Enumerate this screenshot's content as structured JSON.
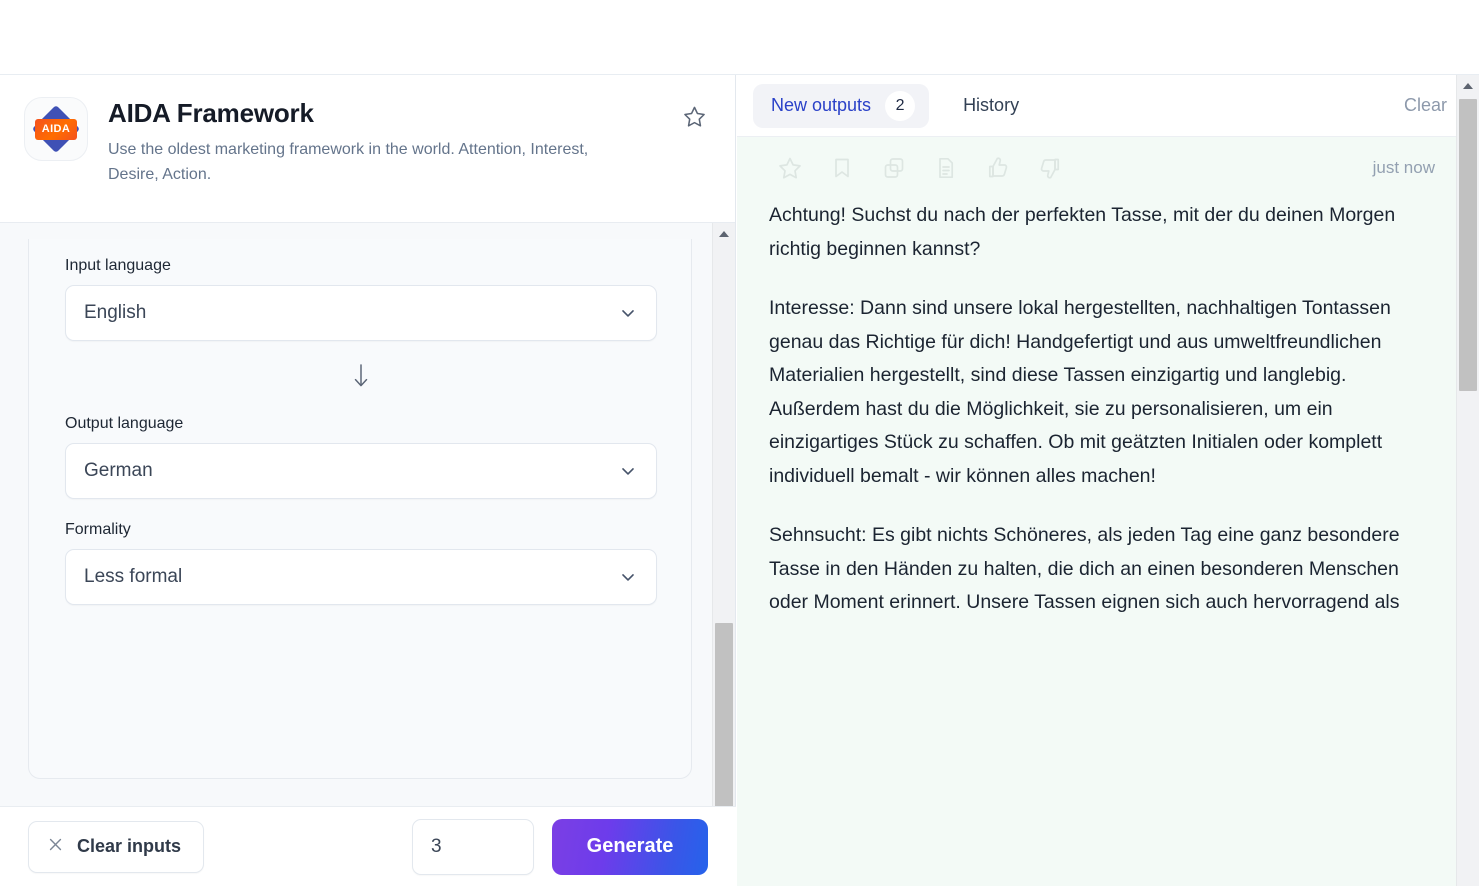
{
  "tool": {
    "logo_text": "AIDA",
    "title": "AIDA Framework",
    "description": "Use the oldest marketing framework in the world. Attention, Interest, Desire, Action.",
    "favorite_icon": "star-outline-icon"
  },
  "form": {
    "fields": [
      {
        "label": "Input language",
        "value": "English",
        "icon": "chevron-down-icon"
      },
      {
        "label": "Output language",
        "value": "German",
        "icon": "chevron-down-icon"
      },
      {
        "label": "Formality",
        "value": "Less formal",
        "icon": "chevron-down-icon"
      }
    ],
    "separator_icon": "arrow-down-icon"
  },
  "actions": {
    "clear_inputs_label": "Clear inputs",
    "clear_inputs_icon": "close-x-icon",
    "count_value": "3",
    "generate_label": "Generate"
  },
  "output_panel": {
    "tabs": [
      {
        "label": "New outputs",
        "badge": "2",
        "active": true
      },
      {
        "label": "History",
        "badge": "",
        "active": false
      }
    ],
    "clear_label": "Clear",
    "item_actions": [
      "star-outline-icon",
      "bookmark-icon",
      "copy-icon",
      "document-icon",
      "thumbs-up-icon",
      "thumbs-down-icon"
    ],
    "timestamp": "just now",
    "paragraphs": [
      "Achtung! Suchst du nach der perfekten Tasse, mit der du deinen Morgen richtig beginnen kannst?",
      "Interesse: Dann sind unsere lokal hergestellten, nachhaltigen Tontassen genau das Richtige für dich! Handgefertigt und aus umweltfreundlichen Materialien hergestellt, sind diese Tassen einzigartig und langlebig. Außerdem hast du die Möglichkeit, sie zu personalisieren, um ein einzigartiges Stück zu schaffen. Ob mit geätzten Initialen oder komplett individuell bemalt - wir können alles machen!",
      "Sehnsucht: Es gibt nichts Schöneres, als jeden Tag eine ganz besondere Tasse in den Händen zu halten, die dich an einen besonderen Menschen oder Moment erinnert. Unsere Tassen eignen sich auch hervorragend als"
    ]
  },
  "colors": {
    "accent_blue": "#2a41c8",
    "generate_gradient_start": "#7b3fe4",
    "generate_gradient_end": "#2563eb",
    "logo_diamond": "#3f51b5",
    "logo_badge": "#f4511e",
    "output_bg": "#f3faf6"
  }
}
